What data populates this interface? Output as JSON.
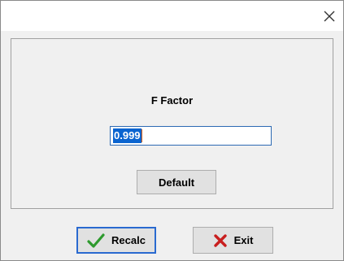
{
  "dialog": {
    "close_icon": "close-icon",
    "label": "F Factor",
    "input_value": "0.999",
    "default_label": "Default",
    "recalc_label": "Recalc",
    "exit_label": "Exit",
    "icons": {
      "recalc": "checkmark-icon",
      "exit": "x-mark-icon"
    },
    "colors": {
      "selection": "#0a64d0",
      "focus_border": "#2a6ad0",
      "check": "#2e9a2e",
      "x_mark": "#c81e1e"
    }
  }
}
